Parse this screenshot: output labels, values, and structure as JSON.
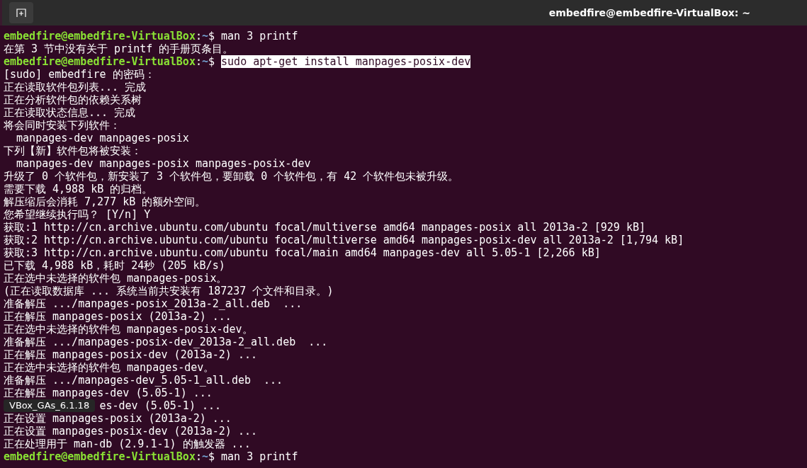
{
  "window": {
    "title": "embedfire@embedfire-VirtualBox: ~"
  },
  "lines": [
    {
      "kind": "prompt",
      "user_host": "embedfire@embedfire-VirtualBox",
      "colon": ":",
      "path": "~",
      "sign": "$",
      "command": "man 3 printf",
      "selected": false
    },
    {
      "kind": "output",
      "text": "在第 3 节中没有关于 printf 的手册页条目。"
    },
    {
      "kind": "prompt",
      "user_host": "embedfire@embedfire-VirtualBox",
      "colon": ":",
      "path": "~",
      "sign": "$",
      "command": "sudo apt-get install manpages-posix-dev",
      "selected": true
    },
    {
      "kind": "output",
      "text": "[sudo] embedfire 的密码："
    },
    {
      "kind": "output",
      "text": "正在读取软件包列表... 完成"
    },
    {
      "kind": "output",
      "text": "正在分析软件包的依赖关系树"
    },
    {
      "kind": "output",
      "text": "正在读取状态信息... 完成"
    },
    {
      "kind": "output",
      "text": "将会同时安装下列软件："
    },
    {
      "kind": "output",
      "text": "  manpages-dev manpages-posix"
    },
    {
      "kind": "output",
      "text": "下列【新】软件包将被安装："
    },
    {
      "kind": "output",
      "text": "  manpages-dev manpages-posix manpages-posix-dev"
    },
    {
      "kind": "output",
      "text": "升级了 0 个软件包，新安装了 3 个软件包，要卸载 0 个软件包，有 42 个软件包未被升级。"
    },
    {
      "kind": "output",
      "text": "需要下载 4,988 kB 的归档。"
    },
    {
      "kind": "output",
      "text": "解压缩后会消耗 7,277 kB 的额外空间。"
    },
    {
      "kind": "output",
      "text": "您希望继续执行吗？ [Y/n] Y"
    },
    {
      "kind": "output",
      "text": "获取:1 http://cn.archive.ubuntu.com/ubuntu focal/multiverse amd64 manpages-posix all 2013a-2 [929 kB]"
    },
    {
      "kind": "output",
      "text": "获取:2 http://cn.archive.ubuntu.com/ubuntu focal/multiverse amd64 manpages-posix-dev all 2013a-2 [1,794 kB]"
    },
    {
      "kind": "output",
      "text": "获取:3 http://cn.archive.ubuntu.com/ubuntu focal/main amd64 manpages-dev all 5.05-1 [2,266 kB]"
    },
    {
      "kind": "output",
      "text": "已下载 4,988 kB，耗时 24秒 (205 kB/s)"
    },
    {
      "kind": "output",
      "text": "正在选中未选择的软件包 manpages-posix。"
    },
    {
      "kind": "output",
      "text": "(正在读取数据库 ... 系统当前共安装有 187237 个文件和目录。)"
    },
    {
      "kind": "output",
      "text": "准备解压 .../manpages-posix_2013a-2_all.deb  ..."
    },
    {
      "kind": "output",
      "text": "正在解压 manpages-posix (2013a-2) ..."
    },
    {
      "kind": "output",
      "text": "正在选中未选择的软件包 manpages-posix-dev。"
    },
    {
      "kind": "output",
      "text": "准备解压 .../manpages-posix-dev_2013a-2_all.deb  ..."
    },
    {
      "kind": "output",
      "text": "正在解压 manpages-posix-dev (2013a-2) ..."
    },
    {
      "kind": "output",
      "text": "正在选中未选择的软件包 manpages-dev。"
    },
    {
      "kind": "output",
      "text": "准备解压 .../manpages-dev_5.05-1_all.deb  ..."
    },
    {
      "kind": "output",
      "text": "正在解压 manpages-dev (5.05-1) ..."
    },
    {
      "kind": "covered",
      "text": "es-dev (5.05-1) ..."
    },
    {
      "kind": "output",
      "text": "正在设置 manpages-posix (2013a-2) ..."
    },
    {
      "kind": "output",
      "text": "正在设置 manpages-posix-dev (2013a-2) ..."
    },
    {
      "kind": "output",
      "text": "正在处理用于 man-db (2.9.1-1) 的触发器 ..."
    },
    {
      "kind": "prompt",
      "user_host": "embedfire@embedfire-VirtualBox",
      "colon": ":",
      "path": "~",
      "sign": "$",
      "command": "man 3 printf",
      "selected": false
    }
  ],
  "tooltip": {
    "text": "VBox_GAs_6.1.18"
  }
}
